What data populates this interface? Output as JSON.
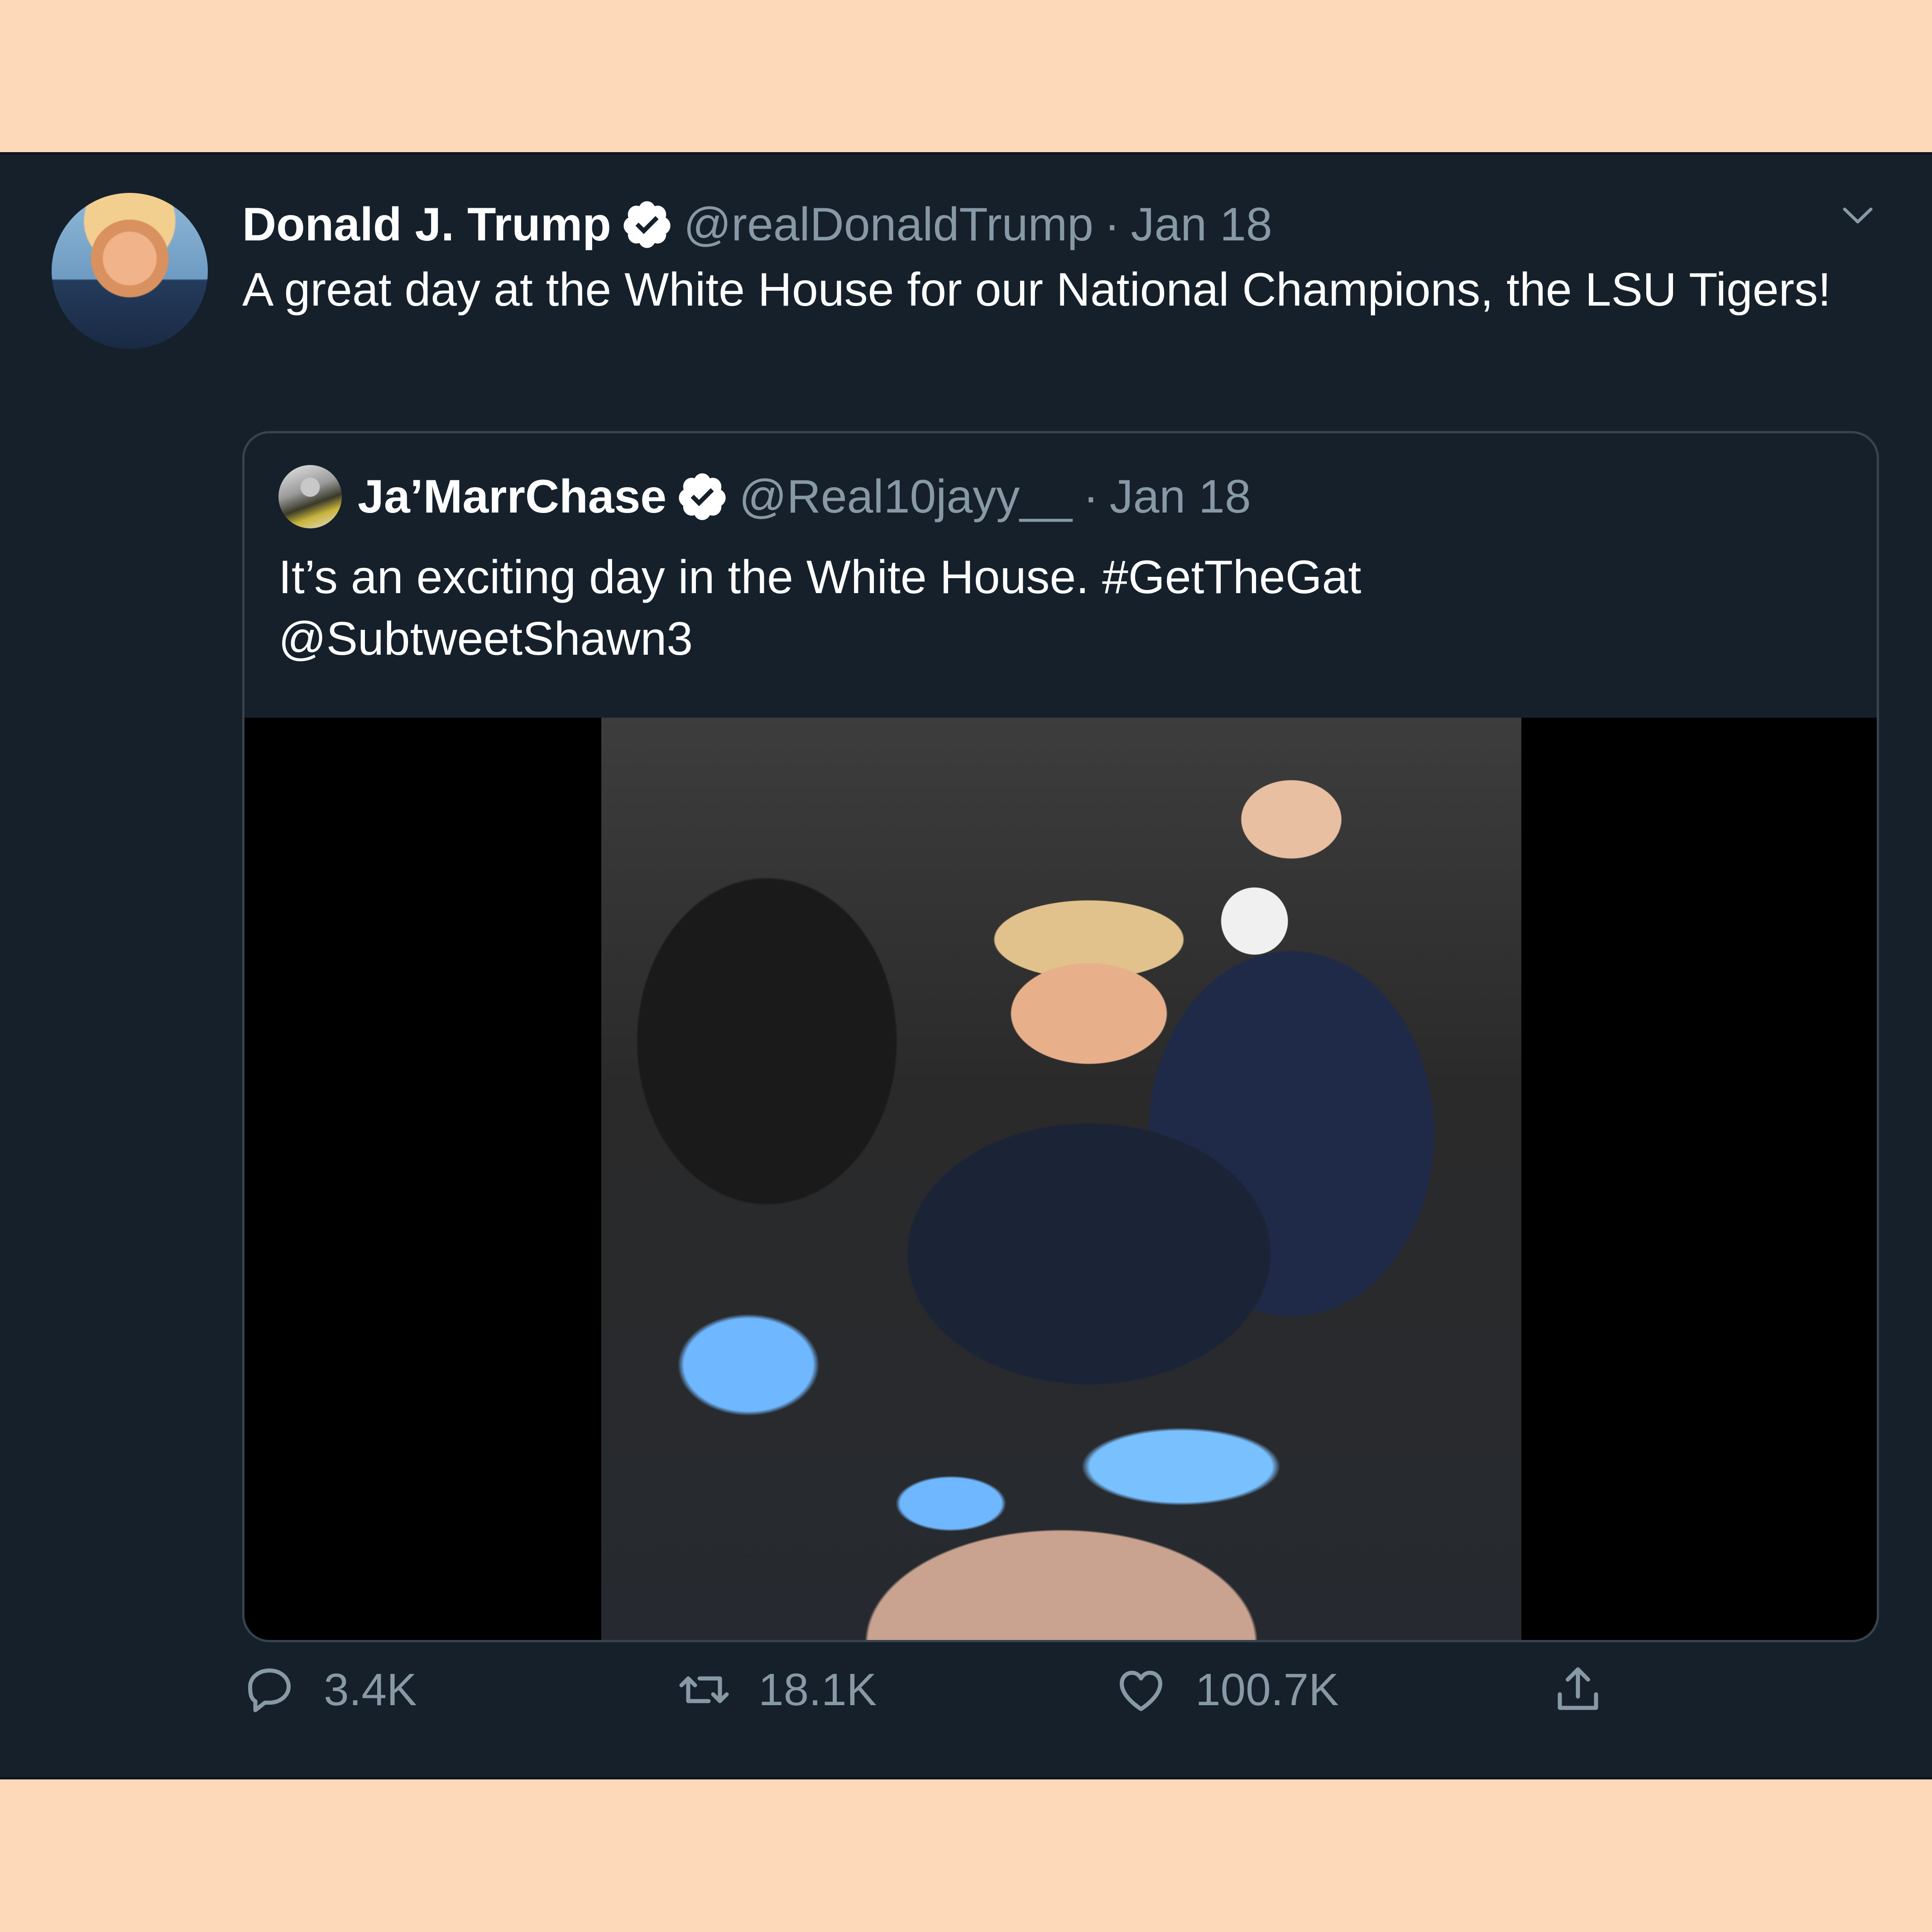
{
  "tweet": {
    "author_name": "Donald J. Trump",
    "author_handle": "@realDonaldTrump",
    "separator": "·",
    "date": "Jan 18",
    "text": "A great day at the White House for our National Champions, the LSU Tigers!",
    "verified": true
  },
  "quoted": {
    "author_name": "Ja’MarrChase",
    "author_handle": "@Real10jayy__",
    "separator": "·",
    "date": "Jan 18",
    "text_line1": "It’s an exciting day in the White House. #GetTheGat",
    "text_line2": "@SubtweetShawn3",
    "verified": true
  },
  "actions": {
    "reply_count": "3.4K",
    "retweet_count": "18.1K",
    "like_count": "100.7K"
  },
  "icons": [
    "chevron-down-icon",
    "verified-badge-icon",
    "reply-icon",
    "retweet-icon",
    "like-icon",
    "share-icon"
  ],
  "colors": {
    "background": "#fdd9b9",
    "card": "#15202b",
    "text": "#ffffff",
    "secondary_text": "#8899a6",
    "quote_border": "#38444d"
  }
}
